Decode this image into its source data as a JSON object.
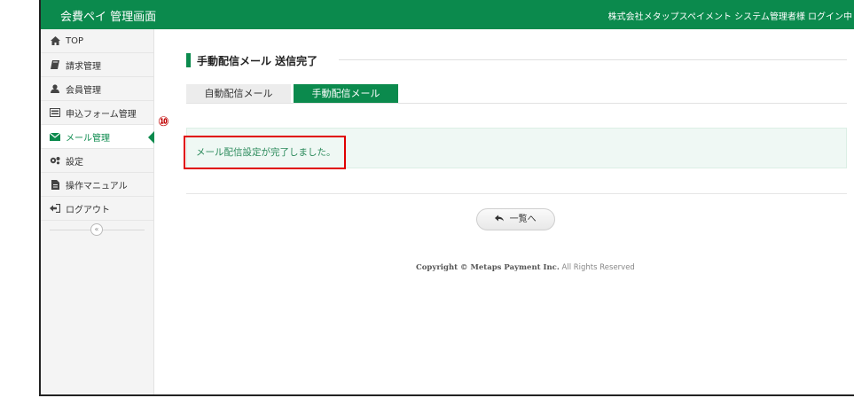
{
  "header": {
    "brand": "会費ペイ 管理画面",
    "user_info": "株式会社メタップスペイメント システム管理者様 ログイン中"
  },
  "sidebar": {
    "items": [
      {
        "label": "TOP",
        "icon": "home-icon"
      },
      {
        "label": "請求管理",
        "icon": "book-icon"
      },
      {
        "label": "会員管理",
        "icon": "user-icon"
      },
      {
        "label": "申込フォーム管理",
        "icon": "form-icon"
      },
      {
        "label": "メール管理",
        "icon": "mail-icon",
        "active": true
      },
      {
        "label": "設定",
        "icon": "gears-icon"
      },
      {
        "label": "操作マニュアル",
        "icon": "document-icon"
      },
      {
        "label": "ログアウト",
        "icon": "logout-icon"
      }
    ],
    "collapse_symbol": "«"
  },
  "annotation": {
    "marker": "⑩",
    "color": "#e00000"
  },
  "main": {
    "title": "手動配信メール 送信完了",
    "tabs": [
      {
        "label": "自動配信メール",
        "active": false
      },
      {
        "label": "手動配信メール",
        "active": true
      }
    ],
    "alert_message": "メール配信設定が完了しました。",
    "back_button_label": "一覧へ"
  },
  "footer": {
    "copyright_bold": "Copyright © Metaps Payment Inc.",
    "copyright_rest": " All Rights Reserved"
  },
  "colors": {
    "brand_green": "#0b8a4d",
    "alert_text": "#2b8a5b"
  }
}
